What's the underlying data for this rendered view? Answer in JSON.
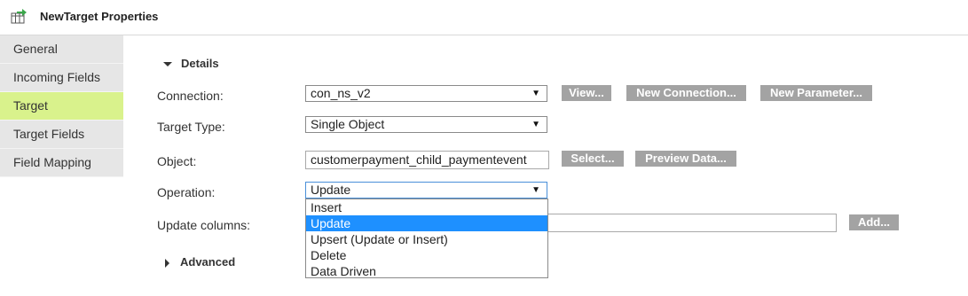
{
  "header": {
    "title": "NewTarget Properties",
    "icon": "target-table-icon"
  },
  "sidebar": {
    "items": [
      {
        "label": "General"
      },
      {
        "label": "Incoming Fields"
      },
      {
        "label": "Target",
        "active": true
      },
      {
        "label": "Target Fields"
      },
      {
        "label": "Field Mapping"
      }
    ]
  },
  "details": {
    "section_label": "Details",
    "connection": {
      "label": "Connection:",
      "value": "con_ns_v2",
      "buttons": [
        "View...",
        "New Connection...",
        "New Parameter..."
      ]
    },
    "target_type": {
      "label": "Target Type:",
      "value": "Single Object"
    },
    "object": {
      "label": "Object:",
      "value": "customerpayment_child_paymentevent",
      "buttons": [
        "Select...",
        "Preview Data..."
      ]
    },
    "operation": {
      "label": "Operation:",
      "value": "Update",
      "options": [
        "Insert",
        "Update",
        "Upsert (Update or Insert)",
        "Delete",
        "Data Driven"
      ],
      "selected_option": "Update"
    },
    "update_columns": {
      "label": "Update columns:",
      "value": "",
      "button": "Add..."
    }
  },
  "advanced": {
    "section_label": "Advanced"
  },
  "colors": {
    "active_tab": "#d9f28c",
    "button_bg": "#a3a3a3",
    "selected_option": "#1e90ff"
  }
}
